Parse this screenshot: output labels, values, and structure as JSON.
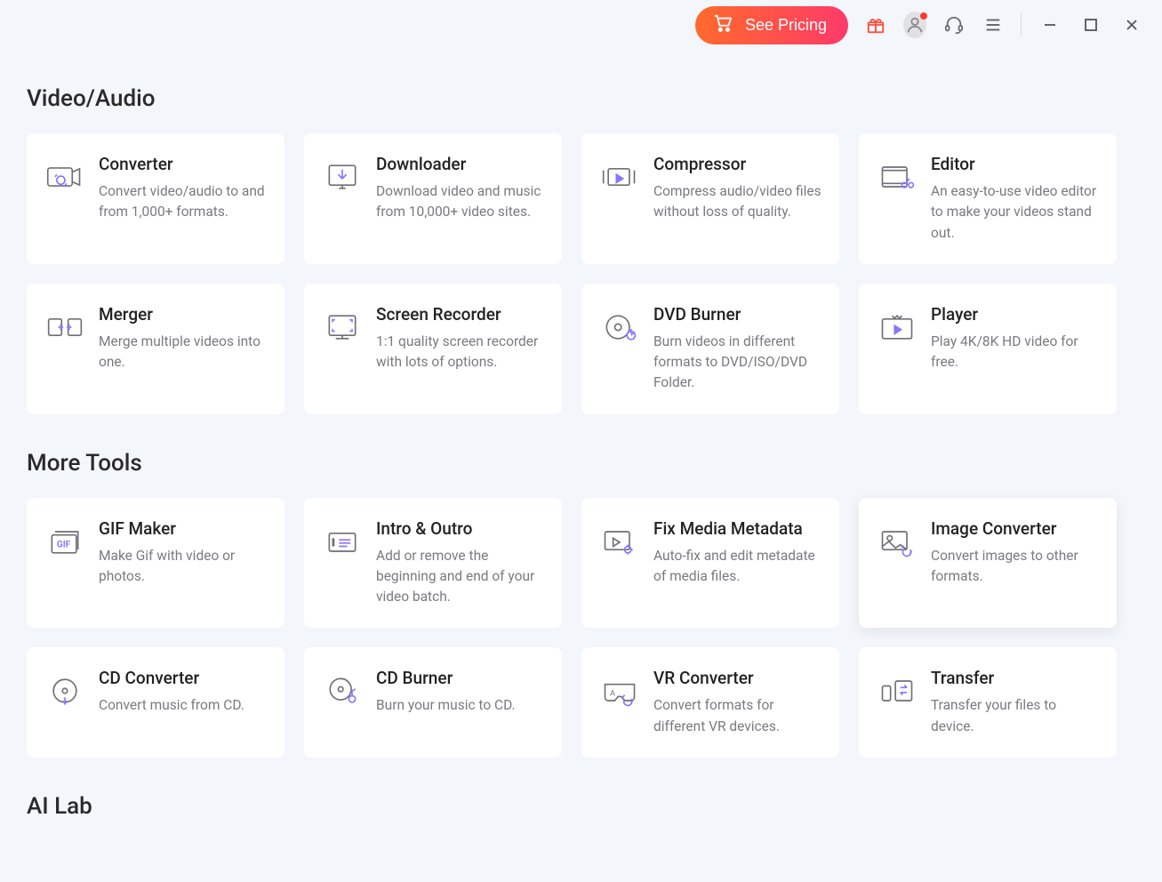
{
  "topbar": {
    "pricing_label": "See Pricing"
  },
  "sections": [
    {
      "title": "Video/Audio",
      "cards": [
        {
          "icon": "converter-icon",
          "title": "Converter",
          "desc": "Convert video/audio to and from 1,000+ formats."
        },
        {
          "icon": "downloader-icon",
          "title": "Downloader",
          "desc": "Download video and music from 10,000+ video sites."
        },
        {
          "icon": "compressor-icon",
          "title": "Compressor",
          "desc": "Compress audio/video files without loss of quality."
        },
        {
          "icon": "editor-icon",
          "title": "Editor",
          "desc": "An easy-to-use video editor to make your videos stand out."
        },
        {
          "icon": "merger-icon",
          "title": "Merger",
          "desc": "Merge multiple videos into one."
        },
        {
          "icon": "screen-recorder-icon",
          "title": "Screen Recorder",
          "desc": "1:1 quality screen recorder with lots of options."
        },
        {
          "icon": "dvd-burner-icon",
          "title": "DVD Burner",
          "desc": "Burn videos in different formats to DVD/ISO/DVD Folder."
        },
        {
          "icon": "player-icon",
          "title": "Player",
          "desc": "Play 4K/8K HD video for free."
        }
      ]
    },
    {
      "title": "More Tools",
      "cards": [
        {
          "icon": "gif-maker-icon",
          "title": "GIF Maker",
          "desc": "Make Gif with video or photos."
        },
        {
          "icon": "intro-outro-icon",
          "title": "Intro & Outro",
          "desc": "Add or remove the beginning and end of your video batch."
        },
        {
          "icon": "fix-metadata-icon",
          "title": "Fix Media Metadata",
          "desc": "Auto-fix and edit metadate of media files."
        },
        {
          "icon": "image-converter-icon",
          "title": "Image Converter",
          "desc": "Convert images to other formats.",
          "selected": true
        },
        {
          "icon": "cd-converter-icon",
          "title": "CD Converter",
          "desc": "Convert music from CD."
        },
        {
          "icon": "cd-burner-icon",
          "title": "CD Burner",
          "desc": "Burn your music to CD."
        },
        {
          "icon": "vr-converter-icon",
          "title": "VR Converter",
          "desc": "Convert formats for different VR devices."
        },
        {
          "icon": "transfer-icon",
          "title": "Transfer",
          "desc": "Transfer your files to device."
        }
      ]
    },
    {
      "title": "AI Lab",
      "cards": []
    }
  ],
  "icons": {
    "converter-icon": "<svg viewBox='0 0 48 40' fill='none' stroke-width='1.8'><rect x='3' y='9' width='30' height='22' rx='3'/><path d='M33 14 L42 10 V30 L33 26' /><path d='M14 24a5 5 0 1 0 10 0 5 5 0 1 0-10 0' stroke='#8b74ff'/><path d='M12 20l2-3M26 28l-2 3' stroke='#8b74ff'/></svg>",
    "downloader-icon": "<svg viewBox='0 0 48 40' fill='none' stroke-width='1.8'><rect x='8' y='6' width='32' height='24' rx='2'/><path d='M20 34h8M24 30v4'/><path d='M24 11v10M19 17l5 5 5-5' stroke='#8b74ff'/></svg>",
    "compressor-icon": "<svg viewBox='0 0 48 40' fill='none' stroke-width='1.8'><rect x='10' y='10' width='26' height='20' rx='2'/><path d='M4 12v16M42 12v16' stroke='#6f6f76'/><path d='M20 17l8 5-8 5z' fill='#8b74ff' stroke='#8b74ff'/></svg>",
    "editor-icon": "<svg viewBox='0 0 48 40' fill='none' stroke-width='1.8'><rect x='6' y='8' width='30' height='24' rx='2'/><path d='M6 12h30M6 28h30'/><circle cx='33' cy='30' r='3' stroke='#8b74ff'/><circle cx='41' cy='30' r='3' stroke='#8b74ff'/><path d='M35 28l4-6' stroke='#8b74ff'/></svg>",
    "merger-icon": "<svg viewBox='0 0 48 40' fill='none' stroke-width='1.8'><rect x='4' y='10' width='16' height='20' rx='2'/><rect x='28' y='10' width='16' height='20' rx='2'/><path d='M16 20h4M28 20h4' stroke='#8b74ff'/><path d='M18 17l3 3-3 3M30 23l-3-3 3-3' stroke='#8b74ff'/></svg>",
    "screen-recorder-icon": "<svg viewBox='0 0 48 40' fill='none' stroke-width='1.8'><rect x='8' y='6' width='32' height='24' rx='2'/><path d='M16 34h16M24 30v4'/><path d='M15 11h-3v3M33 11h3v3M15 25h-3v-3M33 25h3v-3' stroke='#8b74ff'/></svg>",
    "dvd-burner-icon": "<svg viewBox='0 0 48 40' fill='none' stroke-width='1.8'><circle cx='22' cy='20' r='14'/><circle cx='22' cy='20' r='4'/><path d='M33 30a5 5 0 1 0 10 0 5 5 0 1 0-10 0' stroke='#8b74ff'/><path d='M38 22v6M42 26l-4 4' stroke='#8b74ff'/></svg>",
    "player-icon": "<svg viewBox='0 0 48 40' fill='none' stroke-width='1.8'><rect x='6' y='10' width='36' height='24' rx='2'/><path d='M18 6l3 3 3-3 3 3 3-3'/><path d='M21 18l8 5-8 5z' fill='#8b74ff' stroke='#8b74ff'/></svg>",
    "gif-maker-icon": "<svg viewBox='0 0 48 40' fill='none' stroke-width='1.8'><rect x='8' y='12' width='30' height='22' rx='2'/><path d='M12 8h28v22' /><text x='14' y='27' font-size='11' fill='#8b74ff' stroke='none' font-weight='bold'>GIF</text></svg>",
    "intro-outro-icon": "<svg viewBox='0 0 48 40' fill='none' stroke-width='1.8'><rect x='8' y='10' width='32' height='22' rx='2'/><path d='M13 16v10' stroke='#6f6f76' stroke-width='3'/><path d='M20 18h14M20 22h14M20 26h10' stroke='#8b74ff'/></svg>",
    "fix-metadata-icon": "<svg viewBox='0 0 48 40' fill='none' stroke-width='1.8'><rect x='6' y='8' width='30' height='22' rx='2'/><path d='M16 16l8 5-8 5z' stroke='#6f6f76'/><circle cx='34' cy='30' r='4' stroke='#8b74ff'/><path d='M34 24v3M40 30h-3M34 36v-3M28 30h3' stroke='#8b74ff'/></svg>",
    "image-converter-icon": "<svg viewBox='0 0 48 40' fill='none' stroke-width='1.8'><rect x='6' y='8' width='30' height='22' rx='2'/><circle cx='15' cy='16' r='3'/><path d='M6 26l8-6 8 8 6-4 8 6'/><path d='M32 30a5 5 0 1 0 8 0' stroke='#8b74ff'/><path d='M30 28l2-3M42 32l-2 3' stroke='#8b74ff'/></svg>",
    "cd-converter-icon": "<svg viewBox='0 0 48 40' fill='none' stroke-width='1.8'><circle cx='24' cy='20' r='14'/><circle cx='24' cy='20' r='3'/><path d='M10 20a14 14 0 0 1 14-14' stroke='#6f6f76'/><path d='M22 32l2 4 2-4' stroke='#8b74ff'/><path d='M24 28v6' stroke='#8b74ff'/></svg>",
    "cd-burner-icon": "<svg viewBox='0 0 48 40' fill='none' stroke-width='1.8'><circle cx='22' cy='18' r='13'/><circle cx='22' cy='18' r='3'/><path d='M32 30a4 4 0 1 0 8 0 4 4 0 1 0-8 0' stroke='#8b74ff'/><path d='M36 26v-6l4-2' stroke='#8b74ff'/></svg>",
    "vr-converter-icon": "<svg viewBox='0 0 48 40' fill='none' stroke-width='1.8'><path d='M6 12h36v16a4 4 0 0 1-4 4h-8l-4-5h-4l-4 5h-8a4 4 0 0 1-4-4z'/><text x='12' y='26' font-size='10' fill='#6f6f76' stroke='none'>A</text><path d='M30 30a5 5 0 1 0 8 0' stroke='#8b74ff'/><path d='M28 28l2-3M40 32l-2 3' stroke='#8b74ff'/></svg>",
    "transfer-icon": "<svg viewBox='0 0 48 40' fill='none' stroke-width='1.8'><rect x='6' y='14' width='10' height='18' rx='2'/><rect x='22' y='8' width='20' height='24' rx='2'/><path d='M28 16h8M36 16l-3-3M28 22h8M28 22l3 3' stroke='#8b74ff'/></svg>"
  }
}
